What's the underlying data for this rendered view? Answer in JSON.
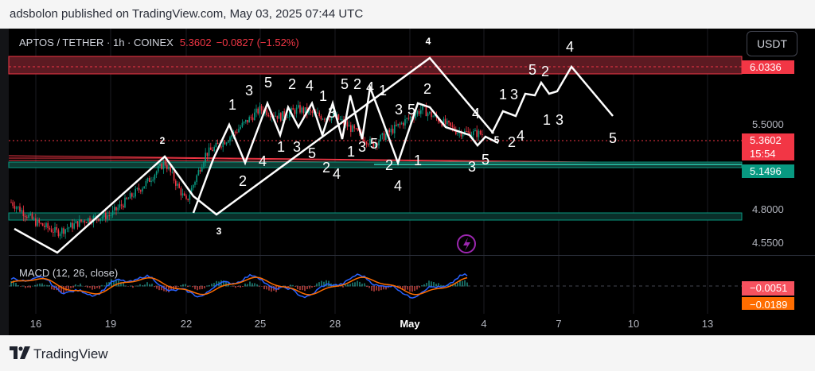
{
  "header": {
    "publish_text": "adsbolon published on TradingView.com, May 03, 2025 07:44 UTC"
  },
  "symbol": {
    "name": "APTOS / TETHER · 1h · COINEX",
    "price": "5.3602",
    "change": "−0.0827 (−1.52%)"
  },
  "currency_button": "USDT",
  "price_tags": {
    "resistance": "6.0336",
    "current": "5.3602",
    "countdown": "15:54",
    "support": "5.1496",
    "macd": "−0.0051",
    "signal": "−0.0189"
  },
  "axis": {
    "price_ticks": [
      "5.5000",
      "4.8000",
      "4.5500"
    ],
    "dates": [
      "16",
      "19",
      "22",
      "25",
      "28",
      "May",
      "4",
      "7",
      "10",
      "13"
    ]
  },
  "macd": {
    "label": "MACD (12, 26, close)"
  },
  "footer": {
    "brand": "TradingView"
  },
  "colors": {
    "down": "#f23645",
    "up": "#089981",
    "macd_line": "#2962ff",
    "signal_line": "#ff6d00"
  },
  "chart_data": {
    "type": "candlestick",
    "title": "APTOS / TETHER · 1h · COINEX",
    "x_range": [
      "Apr 15",
      "May 14"
    ],
    "ylim": [
      4.4,
      6.2
    ],
    "last_price": 5.3602,
    "zones": [
      {
        "name": "resistance",
        "price": 6.0336,
        "color": "#f23645"
      },
      {
        "name": "support",
        "price": 5.1496,
        "color": "#089981"
      },
      {
        "name": "lower support",
        "price": 4.74,
        "color": "#089981"
      }
    ],
    "price_path": [
      [
        "Apr 15",
        4.82
      ],
      [
        "Apr 16",
        4.66
      ],
      [
        "Apr 17",
        4.58
      ],
      [
        "Apr 18",
        4.68
      ],
      [
        "Apr 19",
        4.72
      ],
      [
        "Apr 20",
        4.98
      ],
      [
        "Apr 21",
        5.14
      ],
      [
        "Apr 22",
        4.82
      ],
      [
        "Apr 23",
        5.2
      ],
      [
        "Apr 24",
        5.32
      ],
      [
        "Apr 25",
        5.56
      ],
      [
        "Apr 26",
        5.5
      ],
      [
        "Apr 27",
        5.56
      ],
      [
        "Apr 28",
        5.5
      ],
      [
        "Apr 29",
        5.5
      ],
      [
        "Apr 30",
        5.28
      ],
      [
        "May 1",
        5.56
      ],
      [
        "May 2",
        5.38
      ],
      [
        "May 3",
        5.3602
      ]
    ],
    "wave_labels": [
      "1",
      "2",
      "3",
      "4",
      "5"
    ],
    "macd": {
      "name": "MACD (12, 26, close)",
      "macd": -0.0051,
      "signal": -0.0189
    }
  }
}
